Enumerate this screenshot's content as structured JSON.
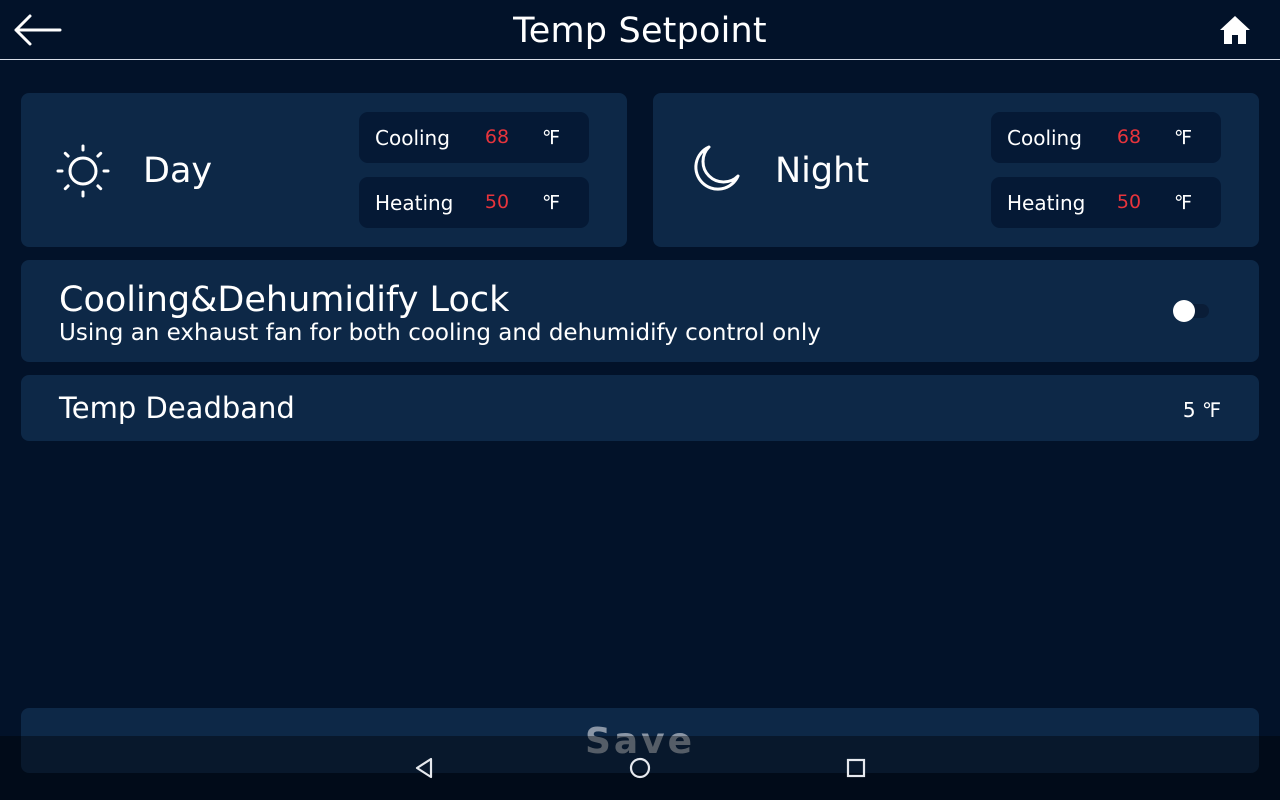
{
  "header": {
    "title": "Temp Setpoint",
    "back_icon": "arrow-left-icon",
    "home_icon": "home-icon"
  },
  "day": {
    "label": "Day",
    "icon": "sun-icon",
    "cooling": {
      "label": "Cooling",
      "value": "68",
      "unit": "℉"
    },
    "heating": {
      "label": "Heating",
      "value": "50",
      "unit": "℉"
    }
  },
  "night": {
    "label": "Night",
    "icon": "moon-icon",
    "cooling": {
      "label": "Cooling",
      "value": "68",
      "unit": "℉"
    },
    "heating": {
      "label": "Heating",
      "value": "50",
      "unit": "℉"
    }
  },
  "lock": {
    "title": "Cooling&Dehumidify Lock",
    "description": "Using an exhaust fan for both cooling and dehumidify control only",
    "enabled": false
  },
  "deadband": {
    "title": "Temp Deadband",
    "value": "5 ℉"
  },
  "save": {
    "label": "Save"
  },
  "navbar": {
    "back_icon": "nav-back-icon",
    "home_icon": "nav-home-icon",
    "recents_icon": "nav-recents-icon"
  },
  "colors": {
    "background": "#021229",
    "card": "#0d2847",
    "inner_row": "#051935",
    "value_red": "#e8343c",
    "save_text": "#8a96a6"
  }
}
